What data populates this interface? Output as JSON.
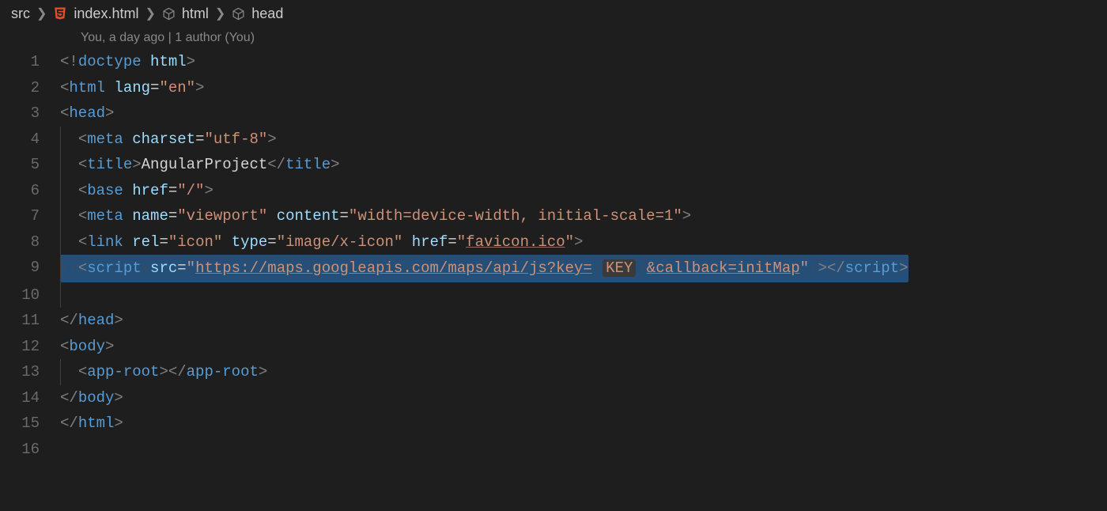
{
  "breadcrumb": {
    "items": [
      {
        "label": "src",
        "icon": null
      },
      {
        "label": "index.html",
        "icon": "html"
      },
      {
        "label": "html",
        "icon": "cube"
      },
      {
        "label": "head",
        "icon": "cube"
      }
    ]
  },
  "codelens": "You, a day ago | 1 author (You)",
  "lines": {
    "l1": {
      "num": "1"
    },
    "l2": {
      "num": "2"
    },
    "l3": {
      "num": "3"
    },
    "l4": {
      "num": "4"
    },
    "l5": {
      "num": "5"
    },
    "l6": {
      "num": "6"
    },
    "l7": {
      "num": "7"
    },
    "l8": {
      "num": "8"
    },
    "l9": {
      "num": "9"
    },
    "l10": {
      "num": "10"
    },
    "l11": {
      "num": "11"
    },
    "l12": {
      "num": "12"
    },
    "l13": {
      "num": "13"
    },
    "l14": {
      "num": "14"
    },
    "l15": {
      "num": "15"
    },
    "l16": {
      "num": "16"
    }
  },
  "code": {
    "doctype_bang": "!",
    "doctype": "doctype",
    "html_kw": "html",
    "lang_attr": "lang",
    "lang_val": "\"en\"",
    "head": "head",
    "meta": "meta",
    "charset_attr": "charset",
    "charset_val": "\"utf-8\"",
    "title": "title",
    "title_text": "AngularProject",
    "base": "base",
    "href_attr": "href",
    "href_root": "\"/\"",
    "name_attr": "name",
    "viewport_val": "\"viewport\"",
    "content_attr": "content",
    "content_val": "\"width=device-width, initial-scale=1\"",
    "link": "link",
    "rel_attr": "rel",
    "rel_val": "\"icon\"",
    "type_attr": "type",
    "type_val": "\"image/x-icon\"",
    "favicon_val_q1": "\"",
    "favicon_url": "favicon.ico",
    "favicon_val_q2": "\"",
    "script": "script",
    "src_attr": "src",
    "maps_q1": "\"",
    "maps_url_left": "https://maps.googleapis.com/maps/api/js?key=",
    "maps_key": "KEY",
    "maps_url_right": "&callback=initMap",
    "maps_q2": "\"",
    "body": "body",
    "approot": "app-root",
    "lt": "<",
    "gt": ">",
    "lts": "</",
    "eq": "=",
    "sp": " ",
    "sp2": "  ",
    "wsdot": "·",
    "indent2": "  "
  }
}
